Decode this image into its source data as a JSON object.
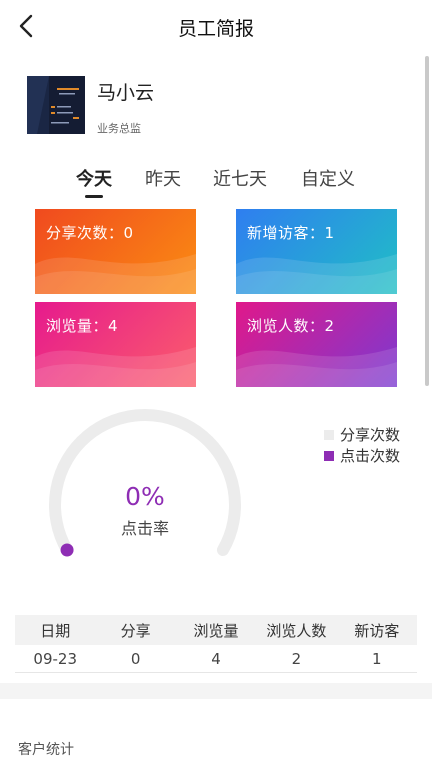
{
  "header": {
    "title": "员工简报"
  },
  "profile": {
    "name": "马小云",
    "role": "业务总监"
  },
  "tabs": [
    {
      "label": "今天",
      "active": true
    },
    {
      "label": "昨天",
      "active": false
    },
    {
      "label": "近七天",
      "active": false
    },
    {
      "label": "自定义",
      "active": false
    }
  ],
  "cards": [
    {
      "label": "分享次数：0"
    },
    {
      "label": "新增访客：1"
    },
    {
      "label": "浏览量：4"
    },
    {
      "label": "浏览人数：2"
    }
  ],
  "gauge": {
    "value": "0%",
    "label": "点击率",
    "fraction": 0
  },
  "legend": [
    {
      "label": "分享次数",
      "color": "#ececec"
    },
    {
      "label": "点击次数",
      "color": "#8e2db4"
    }
  ],
  "table": {
    "headers": [
      "日期",
      "分享",
      "浏览量",
      "浏览人数",
      "新访客"
    ],
    "rows": [
      [
        "09-23",
        "0",
        "4",
        "2",
        "1"
      ]
    ]
  },
  "section": {
    "title": "客户统计"
  },
  "colors": {
    "accent": "#8e2db4",
    "gauge_track": "#ececec"
  }
}
